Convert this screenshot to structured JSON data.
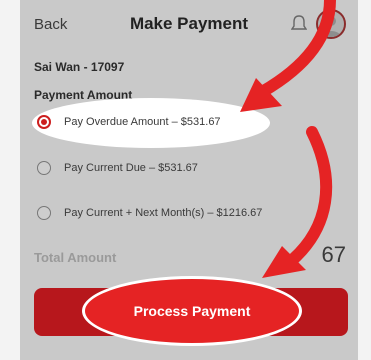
{
  "header": {
    "back_label": "Back",
    "title": "Make Payment"
  },
  "account": {
    "name": "Sai Wan - 17097"
  },
  "payment": {
    "section_label": "Payment Amount",
    "options": [
      {
        "label": "Pay Overdue Amount – $531.67",
        "selected": true
      },
      {
        "label": "Pay Current Due – $531.67",
        "selected": false
      },
      {
        "label": "Pay Current + Next Month(s) – $1216.67",
        "selected": false
      }
    ]
  },
  "total": {
    "label": "Total Amount",
    "value_visible": "67"
  },
  "action": {
    "process_label": "Process Payment"
  },
  "colors": {
    "accent": "#cc1f1f",
    "button": "#b7171c",
    "annotation_arrow": "#e52324"
  },
  "icons": [
    "bell-icon",
    "avatar",
    "annotation-arrow"
  ]
}
